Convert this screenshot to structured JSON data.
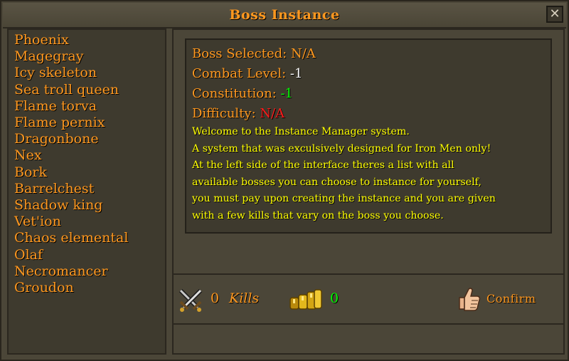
{
  "window": {
    "title": "Boss Instance",
    "close_symbol": "✕"
  },
  "bosses": [
    "Phoenix",
    "Magegray",
    "Icy skeleton",
    "Sea troll queen",
    "Flame torva",
    "Flame pernix",
    "Dragonbone",
    "Nex",
    "Bork",
    "Barrelchest",
    "Shadow king",
    "Vet'ion",
    "Chaos elemental",
    "Olaf",
    "Necromancer",
    "Groudon"
  ],
  "info": {
    "boss_label": "Boss Selected: ",
    "boss_value": "N/A",
    "combat_label": "Combat Level: ",
    "combat_value": "-1",
    "constitution_label": "Constitution: ",
    "constitution_value": "-1",
    "difficulty_label": "Difficulty: ",
    "difficulty_value": "N/A",
    "description": [
      "Welcome to the Instance Manager system.",
      "A system that was exculsively designed for Iron Men only!",
      "At the left side of the interface theres a list with all",
      "available bosses you can choose to instance for yourself,",
      "you must pay upon creating the instance and you are given",
      "with a few kills that vary on the boss you choose."
    ]
  },
  "footer": {
    "kills_count": "0",
    "kills_label": "Kills",
    "coins_count": "0",
    "confirm_label": "Confirm"
  },
  "colors": {
    "orange": "#ff981f",
    "yellow": "#ffff00",
    "green": "#00ff00",
    "red": "#ff1a1a"
  },
  "icons": {
    "kills": "crossed-swords-icon",
    "coins": "coins-icon",
    "confirm": "thumbs-up-icon"
  }
}
